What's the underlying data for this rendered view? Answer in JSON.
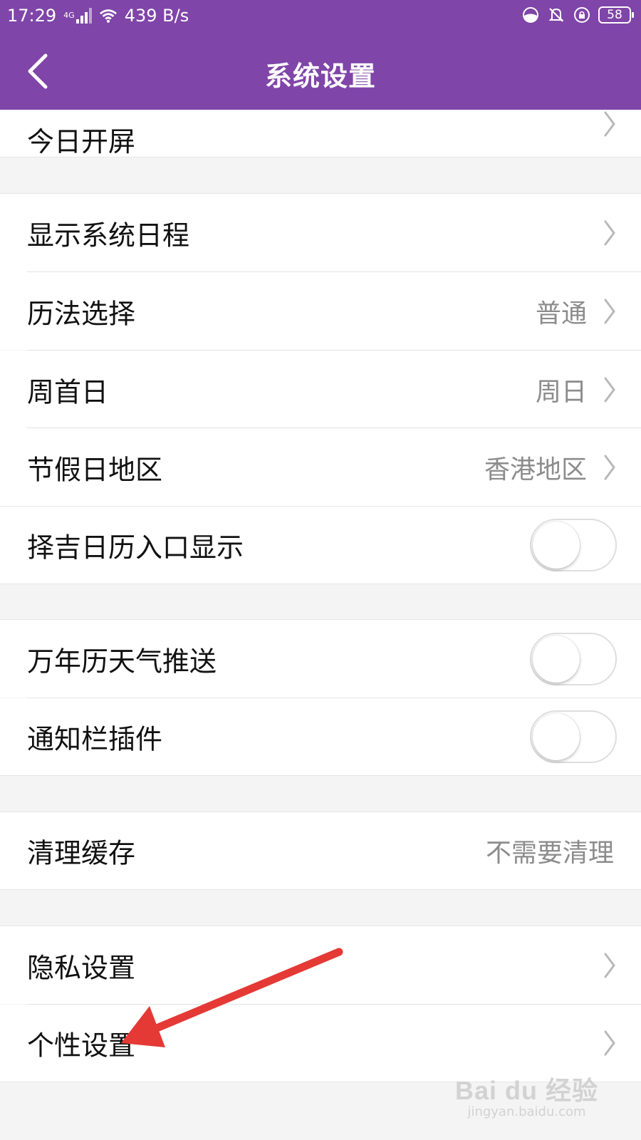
{
  "status_bar": {
    "time": "17:29",
    "network_type": "4G",
    "speed": "439 B/s",
    "battery": "58"
  },
  "navbar": {
    "back_icon": "chevron-left-icon",
    "title": "系统设置"
  },
  "settings": {
    "today_screen": {
      "label": "今日开屏"
    },
    "show_system_schedule": {
      "label": "显示系统日程"
    },
    "calendar_select": {
      "label": "历法选择",
      "value": "普通"
    },
    "week_start": {
      "label": "周首日",
      "value": "周日"
    },
    "holiday_region": {
      "label": "节假日地区",
      "value": "香港地区"
    },
    "lucky_day_entry": {
      "label": "择吉日历入口显示",
      "toggle_on": false
    },
    "weather_push": {
      "label": "万年历天气推送",
      "toggle_on": false
    },
    "notification_widget": {
      "label": "通知栏插件",
      "toggle_on": false
    },
    "clear_cache": {
      "label": "清理缓存",
      "value": "不需要清理"
    },
    "privacy": {
      "label": "隐私设置"
    },
    "personalization": {
      "label": "个性设置"
    }
  },
  "annotation": {
    "arrow_color": "#e53935"
  },
  "watermark": {
    "logo": "Bai du 经验",
    "url": "jingyan.baidu.com"
  },
  "colors": {
    "accent": "#7f45a8",
    "background": "#f4f4f4"
  }
}
